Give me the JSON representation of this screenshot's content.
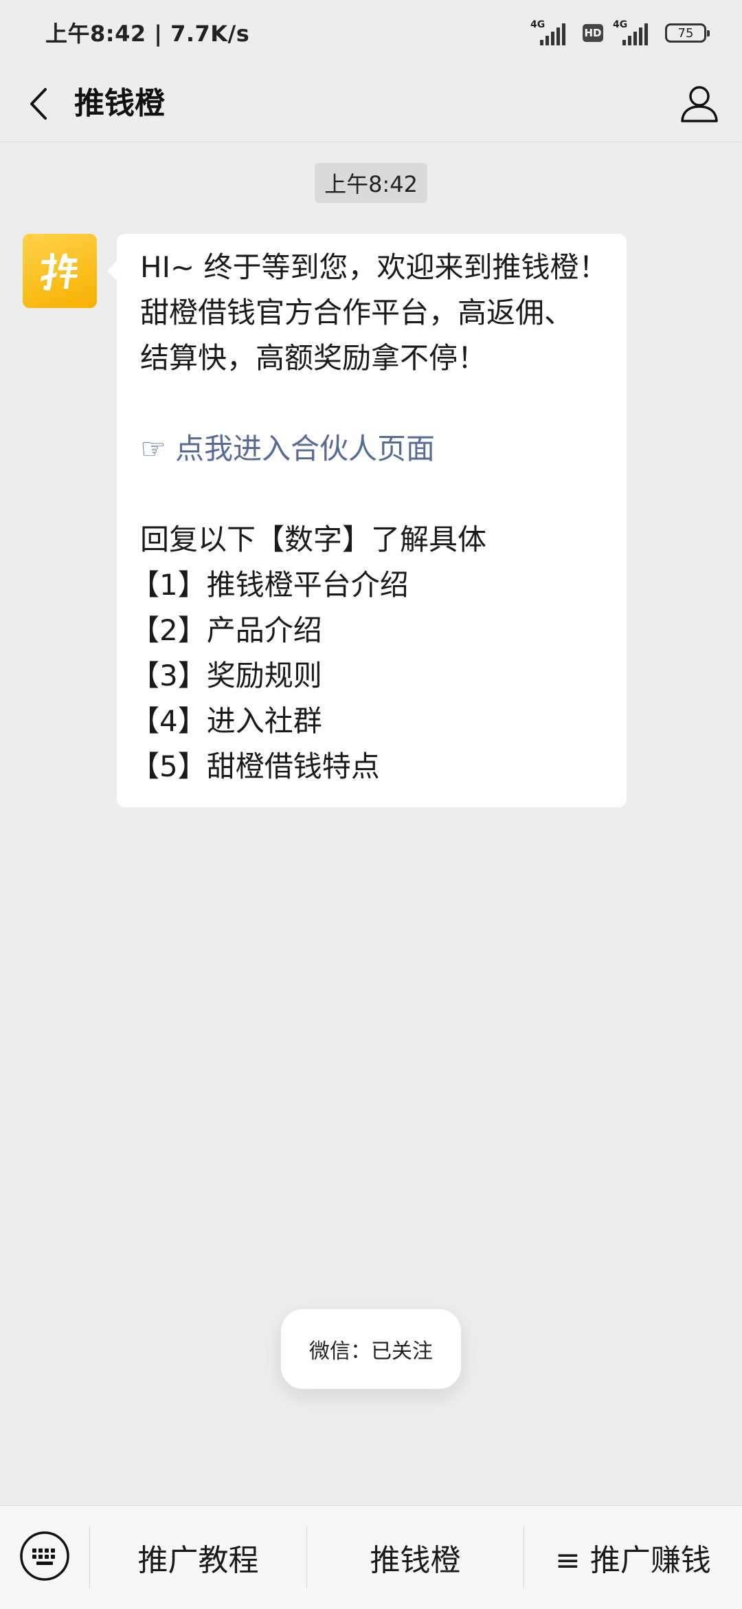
{
  "status_bar": {
    "time": "上午8:42 | 7.7K/s",
    "network_1": "4G",
    "hd": "HD",
    "network_2": "4G",
    "battery": "75"
  },
  "header": {
    "title": "推钱橙"
  },
  "chat": {
    "timestamp": "上午8:42",
    "message": {
      "lines": [
        "HI~ 终于等到您，欢迎来到推钱橙！",
        "甜橙借钱官方合作平台，高返佣、",
        "结算快，高额奖励拿不停！"
      ],
      "link_text": "☞ 点我进入合伙人页面",
      "reply_prompt": "回复以下【数字】了解具体",
      "options": [
        "【1】推钱橙平台介绍",
        "【2】产品介绍",
        "【3】奖励规则",
        "【4】进入社群",
        "【5】甜橙借钱特点"
      ]
    }
  },
  "toast": {
    "text": "微信：已关注"
  },
  "bottom_menu": {
    "items": [
      {
        "label": "推广教程"
      },
      {
        "label": "推钱橙"
      },
      {
        "label": "≡ 推广赚钱"
      }
    ]
  }
}
